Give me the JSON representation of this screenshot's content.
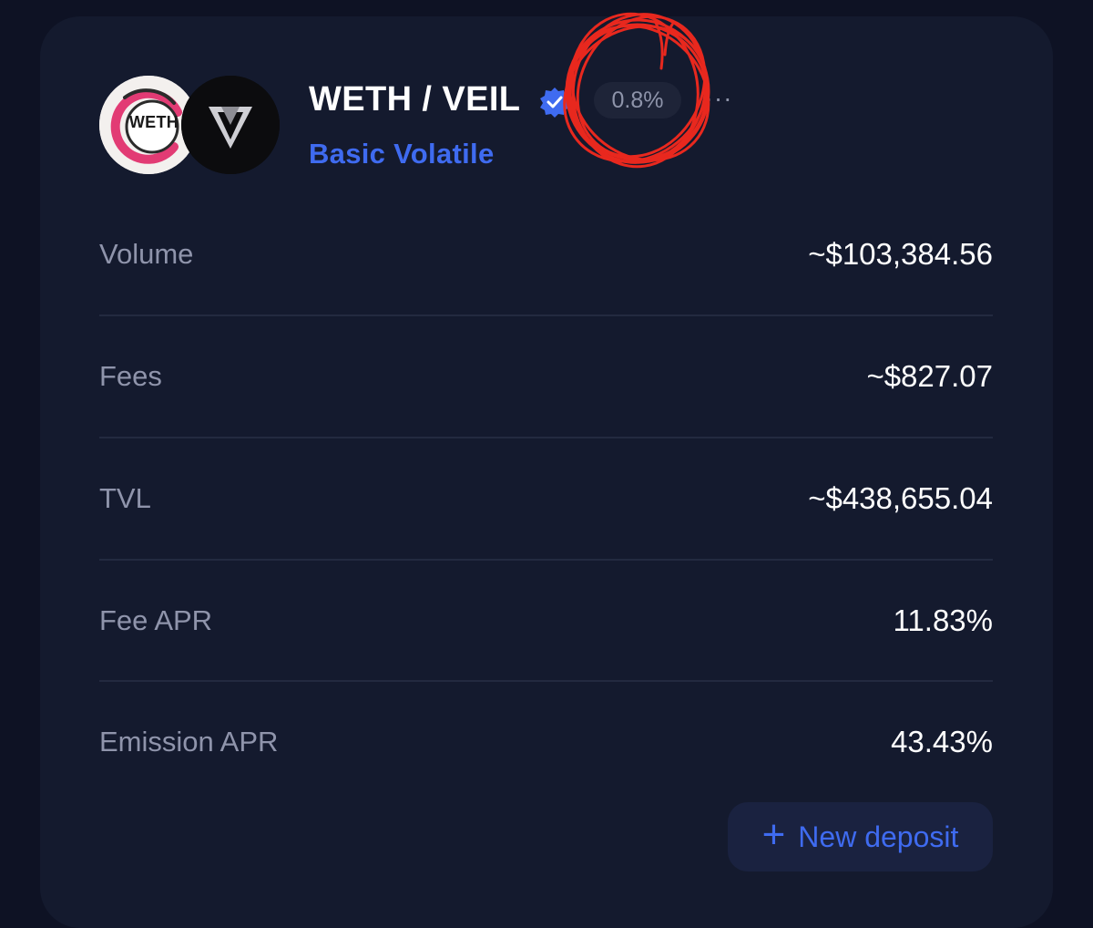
{
  "pool": {
    "title": "WETH / VEIL",
    "type_label": "Basic Volatile",
    "fee_badge": "0.8%",
    "more_label": "···",
    "token_a": {
      "symbol_text": "WETH",
      "icon": "weth-token-icon"
    },
    "token_b": {
      "icon": "veil-token-icon"
    },
    "verified_icon": "verified-check-icon"
  },
  "stats": [
    {
      "label": "Volume",
      "value": "~$103,384.56"
    },
    {
      "label": "Fees",
      "value": "~$827.07"
    },
    {
      "label": "TVL",
      "value": "~$438,655.04"
    },
    {
      "label": "Fee APR",
      "value": "11.83%"
    },
    {
      "label": "Emission APR",
      "value": "43.43%"
    }
  ],
  "actions": {
    "new_deposit_icon": "+",
    "new_deposit_label": "New deposit"
  },
  "colors": {
    "background": "#0e1224",
    "card": "#141a2e",
    "accent": "#3f6bf0",
    "annotation": "#e8281e"
  }
}
